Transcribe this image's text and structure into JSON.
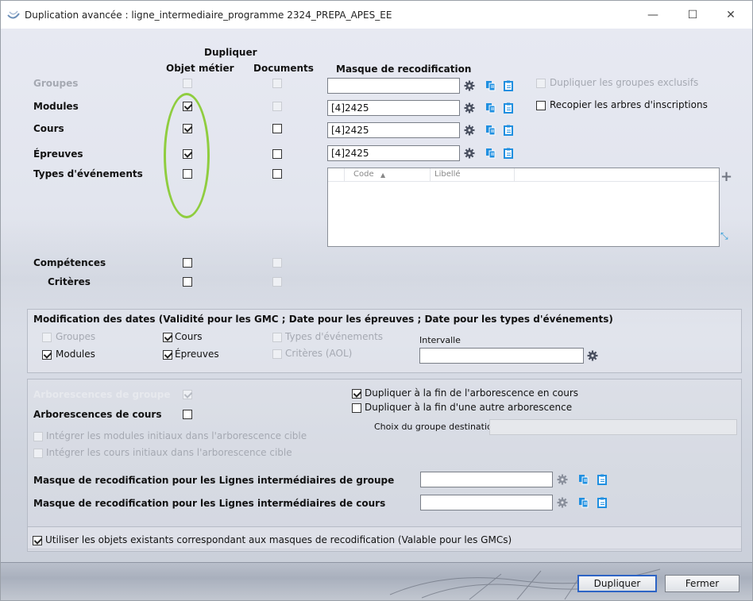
{
  "window": {
    "title": "Duplication avancée : ligne_intermediaire_programme 2324_PREPA_APES_EE",
    "minimize": "—",
    "maximize": "☐",
    "close": "✕"
  },
  "headers": {
    "dupliquer": "Dupliquer",
    "objet_metier": "Objet métier",
    "documents": "Documents",
    "masque": "Masque de recodification"
  },
  "rows": {
    "groupes": "Groupes",
    "modules": "Modules",
    "cours": "Cours",
    "epreuves": "Épreuves",
    "types_evenements": "Types d'événements",
    "competences": "Compétences",
    "criteres": "Critères"
  },
  "masks": {
    "groupes": "",
    "modules": "[4]2425",
    "cours": "[4]2425",
    "epreuves": "[4]2425"
  },
  "options": {
    "dupliquer_groupes_exclusifs": "Dupliquer les groupes exclusifs",
    "recopier_arbres": "Recopier les arbres d'inscriptions"
  },
  "grid": {
    "col_code": "Code",
    "sort_indicator": "▲",
    "col_libelle": "Libellé",
    "add_icon": "+",
    "resize_icon": "⤡"
  },
  "dates": {
    "title": "Modification des dates (Validité pour les GMC ; Date pour les épreuves ; Date pour les types d'événements)",
    "groupes": "Groupes",
    "cours": "Cours",
    "types_evenements": "Types d'événements",
    "modules": "Modules",
    "epreuves": "Épreuves",
    "criteres_aol": "Critères (AOL)",
    "intervalle": "Intervalle",
    "intervalle_value": ""
  },
  "arbo": {
    "groupe": "Arborescences de groupe",
    "cours": "Arborescences de cours",
    "integrer_modules": "Intégrer les modules initiaux dans l'arborescence cible",
    "integrer_cours": "Intégrer les cours initiaux dans l'arborescence cible",
    "fin_en_cours": "Dupliquer à la fin de l'arborescence en cours",
    "fin_autre": "Dupliquer à la fin d'une autre arborescence",
    "choix_groupe": "Choix du groupe destination",
    "choix_groupe_value": "",
    "masque_groupe": "Masque de recodification pour les Lignes intermédiaires de groupe",
    "masque_groupe_value": "",
    "masque_cours": "Masque de recodification pour les Lignes intermédiaires de cours",
    "masque_cours_value": ""
  },
  "utiliser_objets": "Utiliser les objets existants correspondant aux masques de recodification (Valable pour les GMCs)",
  "buttons": {
    "dupliquer": "Dupliquer",
    "fermer": "Fermer"
  },
  "colors": {
    "accent": "#2d64c5",
    "highlight_ring": "#8fcd3f",
    "icon_blue": "#1f8fe0",
    "gear": "#4a5060"
  }
}
